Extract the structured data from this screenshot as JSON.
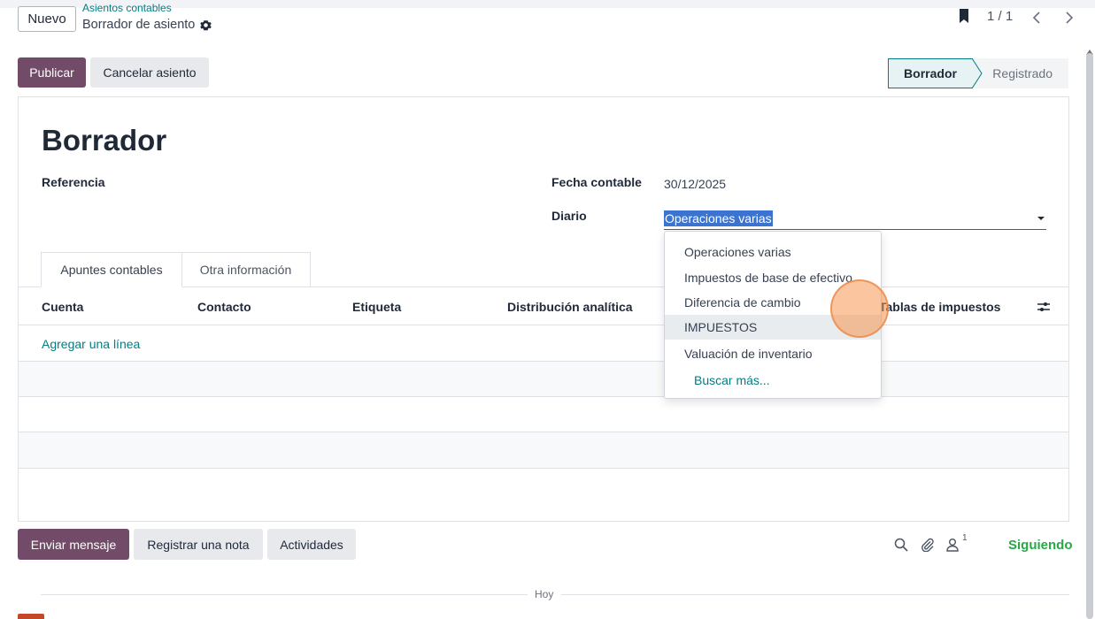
{
  "header": {
    "new_button": "Nuevo",
    "breadcrumb_parent": "Asientos contables",
    "breadcrumb_current": "Borrador de asiento",
    "pager": "1 / 1"
  },
  "actions": {
    "publish": "Publicar",
    "cancel_entry": "Cancelar asiento"
  },
  "status": {
    "stages": [
      "Borrador",
      "Registrado"
    ],
    "current": "Borrador"
  },
  "form": {
    "title": "Borrador",
    "reference_label": "Referencia",
    "date_label": "Fecha contable",
    "date_value": "30/12/2025",
    "journal_label": "Diario",
    "journal_value": "Operaciones varias"
  },
  "tabs": [
    "Apuntes contables",
    "Otra información"
  ],
  "table": {
    "columns": [
      "Cuenta",
      "Contacto",
      "Etiqueta",
      "Distribución analítica",
      "Tablas de impuestos"
    ],
    "add_line": "Agregar una línea"
  },
  "dropdown": {
    "options": [
      "Operaciones varias",
      "Impuestos de base de efectivo",
      "Diferencia de cambio",
      "IMPUESTOS",
      "Valuación de inventario"
    ],
    "highlighted": "IMPUESTOS",
    "search_more": "Buscar más..."
  },
  "chatter": {
    "send_message": "Enviar mensaje",
    "log_note": "Registrar una nota",
    "activities": "Actividades",
    "followers_count": "1",
    "following": "Siguiendo",
    "today": "Hoy"
  },
  "colors": {
    "primary": "#714b67",
    "accent": "#017e84",
    "following": "#28a745"
  }
}
